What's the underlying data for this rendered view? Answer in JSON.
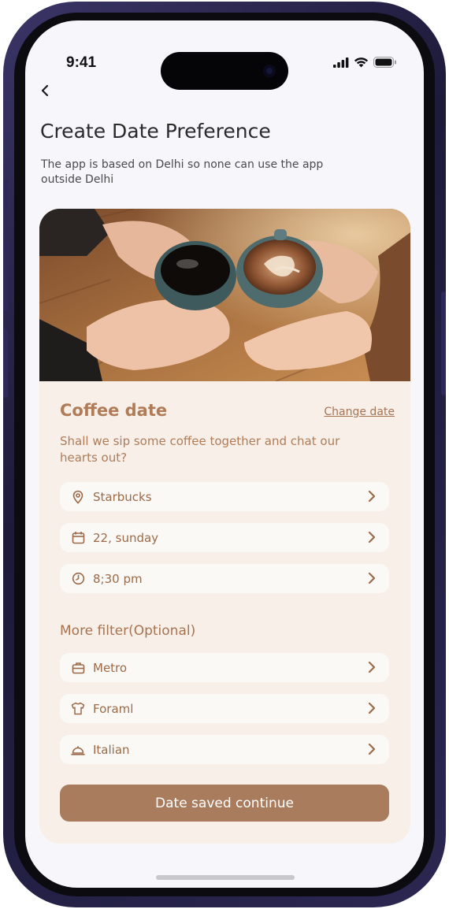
{
  "status": {
    "time": "9:41"
  },
  "header": {
    "title": "Create Date Preference",
    "subtitle": "The app is based on Delhi so none can use the app outside Delhi"
  },
  "card": {
    "title": "Coffee date",
    "change_link": "Change date",
    "description": "Shall we sip some coffee together and chat our hearts out?",
    "details": [
      {
        "label": "Starbucks",
        "icon": "location-pin-icon"
      },
      {
        "label": "22, sunday",
        "icon": "calendar-icon"
      },
      {
        "label": "8;30 pm",
        "icon": "clock-icon"
      }
    ],
    "filters_heading": "More filter(Optional)",
    "filters": [
      {
        "label": "Metro",
        "icon": "briefcase-icon"
      },
      {
        "label": "Foraml",
        "icon": "shirt-icon"
      },
      {
        "label": "Italian",
        "icon": "cloche-icon"
      }
    ],
    "cta_label": "Date saved continue"
  },
  "colors": {
    "accent": "#b07c58",
    "button": "#a97c5e",
    "card_bg": "#f7efe8",
    "screen_bg": "#f7f6fb"
  }
}
